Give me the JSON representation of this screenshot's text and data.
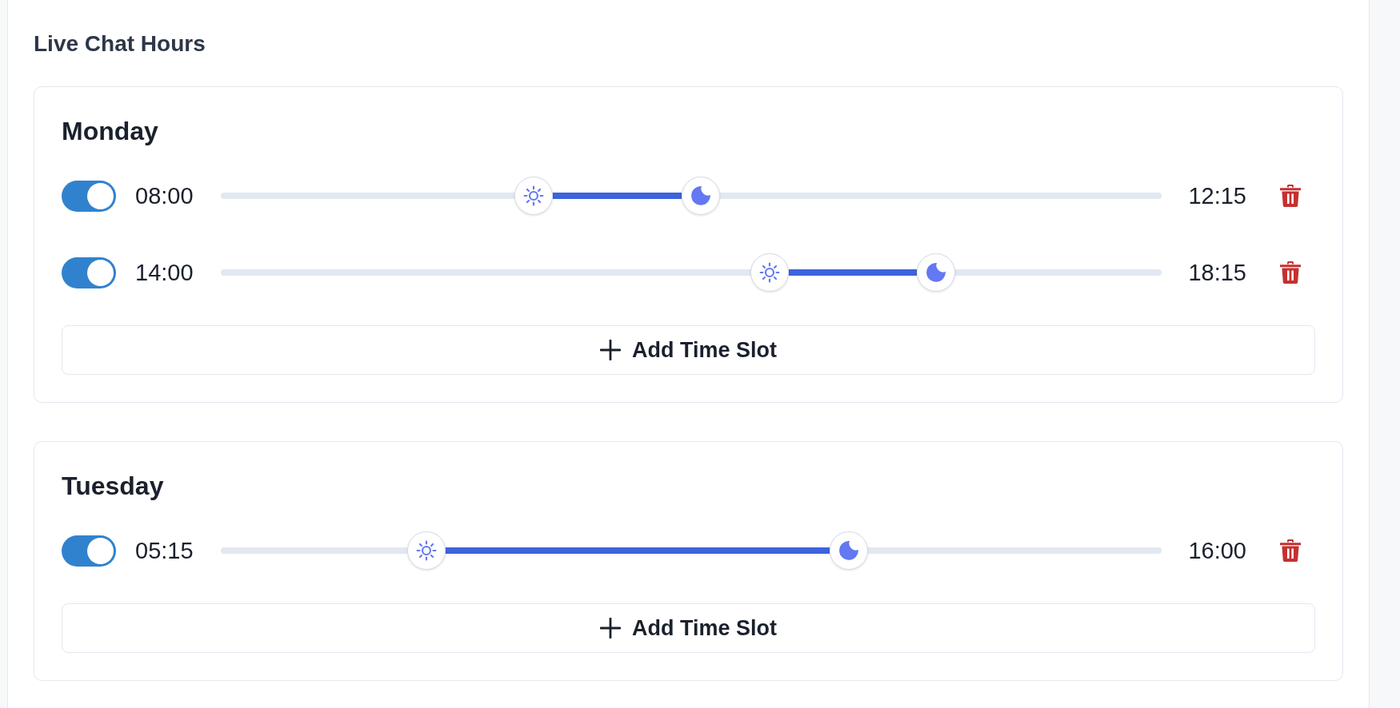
{
  "section": {
    "title": "Live Chat Hours"
  },
  "days": [
    {
      "name": "Monday",
      "slots": [
        {
          "on": true,
          "start": "08:00",
          "end": "12:15",
          "start_thumb": {
            "level": 0.333
          },
          "end_thumb": {
            "level": 0.51
          }
        },
        {
          "on": true,
          "start": "14:00",
          "end": "18:15",
          "start_thumb": {
            "level": 0.583
          },
          "end_thumb": {
            "level": 0.76
          }
        }
      ],
      "add_button": "Add Time Slot"
    },
    {
      "name": "Tuesday",
      "slots": [
        {
          "on": true,
          "start": "05:15",
          "end": "16:00",
          "start_thumb": {
            "level": 0.219
          },
          "end_thumb": {
            "level": 0.667
          }
        }
      ],
      "add_button": "Add Time Slot"
    }
  ]
}
